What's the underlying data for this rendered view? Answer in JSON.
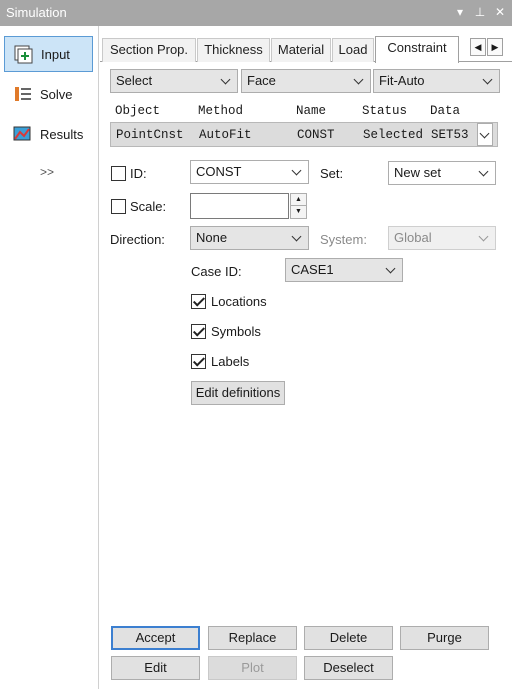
{
  "window": {
    "title": "Simulation"
  },
  "titlebar_icons": [
    "dropdown-icon",
    "pin-icon",
    "close-icon"
  ],
  "nav": {
    "items": [
      {
        "label": "Input",
        "icon": "input-icon",
        "active": true
      },
      {
        "label": "Solve",
        "icon": "solve-icon",
        "active": false
      },
      {
        "label": "Results",
        "icon": "results-icon",
        "active": false
      }
    ],
    "more": ">>"
  },
  "tabs": [
    {
      "label": "Section Prop."
    },
    {
      "label": "Thickness"
    },
    {
      "label": "Material"
    },
    {
      "label": "Load"
    },
    {
      "label": "Constraint",
      "active": true
    }
  ],
  "selectors": {
    "select": "Select",
    "face": "Face",
    "fit": "Fit-Auto"
  },
  "object_table": {
    "headers": [
      "Object",
      "Method",
      "Name",
      "Status",
      "Data"
    ],
    "row": [
      "PointCnst",
      "AutoFit",
      "CONST",
      "Selected",
      "SET53"
    ]
  },
  "form": {
    "id_label": "ID:",
    "id_value": "CONST",
    "set_label": "Set:",
    "set_value": "New set",
    "scale_label": "Scale:",
    "scale_value": "",
    "direction_label": "Direction:",
    "direction_value": "None",
    "system_label": "System:",
    "system_value": "Global",
    "caseid_label": "Case ID:",
    "caseid_value": "CASE1",
    "locations_label": "Locations",
    "symbols_label": "Symbols",
    "labels_label": "Labels",
    "edit_definitions": "Edit definitions"
  },
  "buttons": {
    "accept": "Accept",
    "replace": "Replace",
    "delete": "Delete",
    "purge": "Purge",
    "edit": "Edit",
    "plot": "Plot",
    "deselect": "Deselect"
  },
  "colors": {
    "titlebar": "#a7a7a7",
    "active_nav": "#cce4f7",
    "accent": "#3c7fd0"
  }
}
